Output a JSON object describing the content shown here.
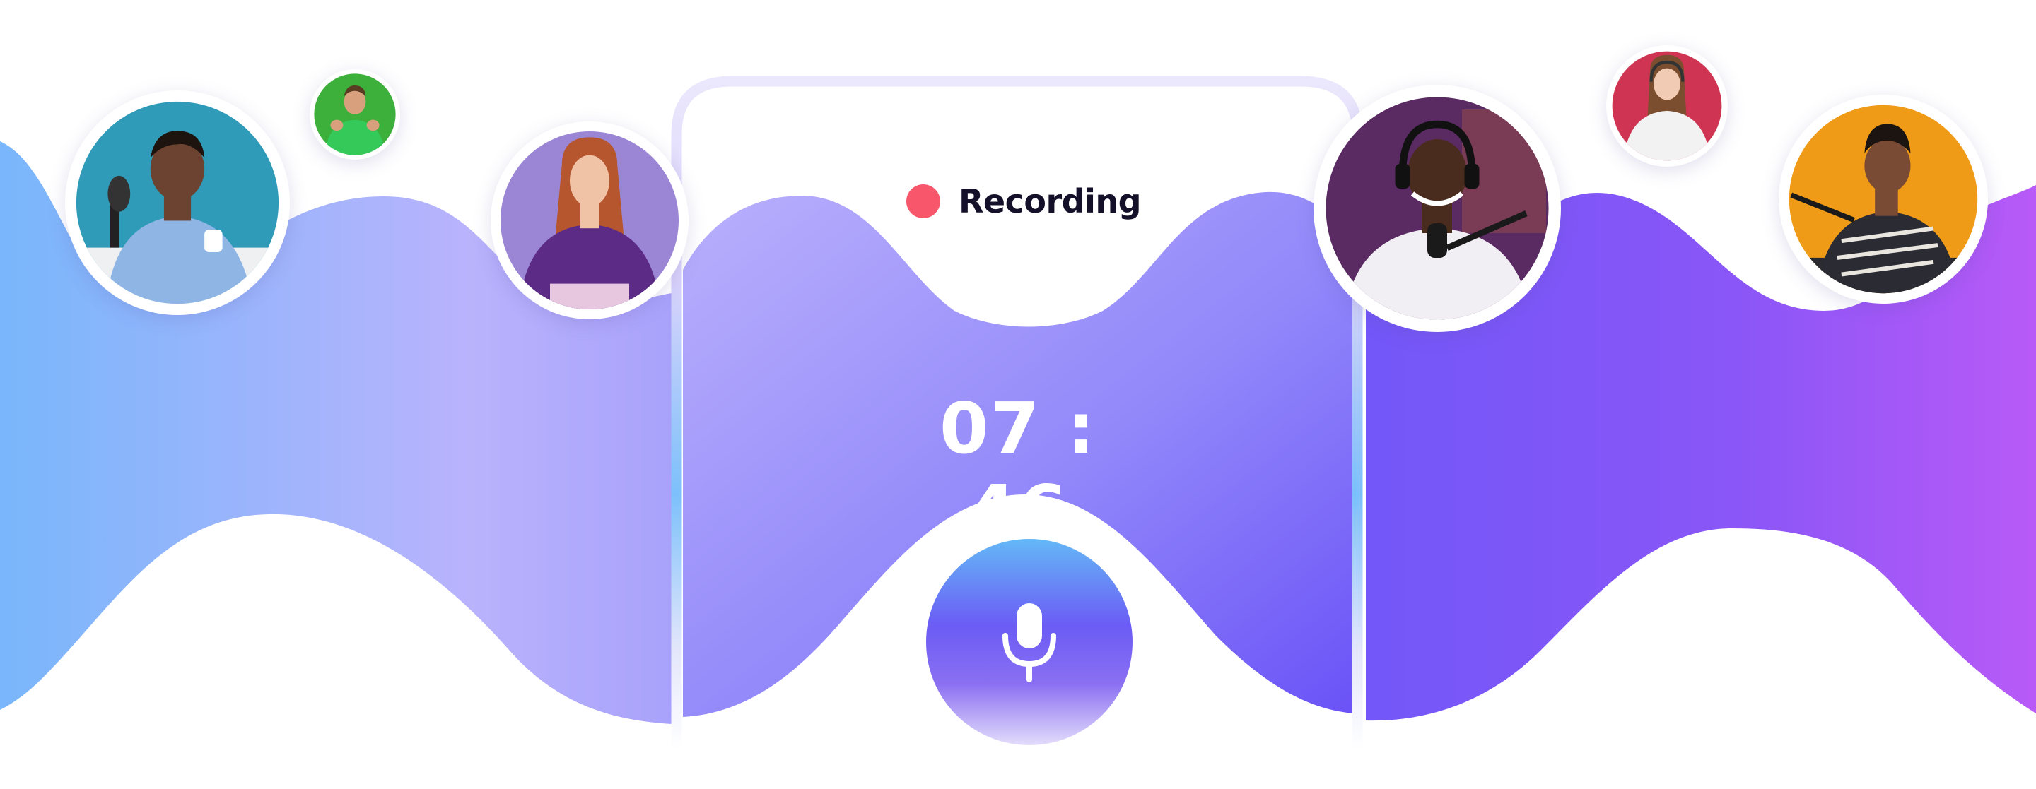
{
  "recording": {
    "status_label": "Recording",
    "status_color": "#f7566b",
    "timer": "07 : 46"
  },
  "mic_button": {
    "icon": "microphone-icon"
  },
  "colors": {
    "wave_left": "#7cb8fb",
    "wave_mid": "#b9b2fc",
    "wave_purple": "#7659f8",
    "wave_right": "#b55cf7",
    "panel_border": "#e6e2fb"
  },
  "participants": [
    {
      "name": "participant-avatar-podcaster-blue",
      "background": "#2f9bb8",
      "shirt": "#8eb5e4",
      "skin": "#6b4330",
      "hair": "#1e140f"
    },
    {
      "name": "participant-avatar-green-hoodie",
      "background": "#3db03b",
      "shirt": "#35c95a",
      "skin": "#d9a07e",
      "hair": "#5a3c22"
    },
    {
      "name": "participant-avatar-purple-sweater",
      "background": "#9b86d6",
      "shirt": "#5c2b86",
      "skin": "#f0c3a6",
      "hair": "#b6562e"
    },
    {
      "name": "participant-avatar-headphones-host",
      "background": "#5a2a63",
      "shirt": "#f1eef4",
      "skin": "#4a2c1f",
      "hair": "#111111"
    },
    {
      "name": "participant-avatar-red-background",
      "background": "#cf3552",
      "shirt": "#f2f2f2",
      "skin": "#f1cbb3",
      "hair": "#7b4e2f"
    },
    {
      "name": "participant-avatar-orange-background",
      "background": "#ef9b17",
      "shirt": "#2b2b33",
      "skin": "#7a4b34",
      "hair": "#1b1410"
    }
  ]
}
